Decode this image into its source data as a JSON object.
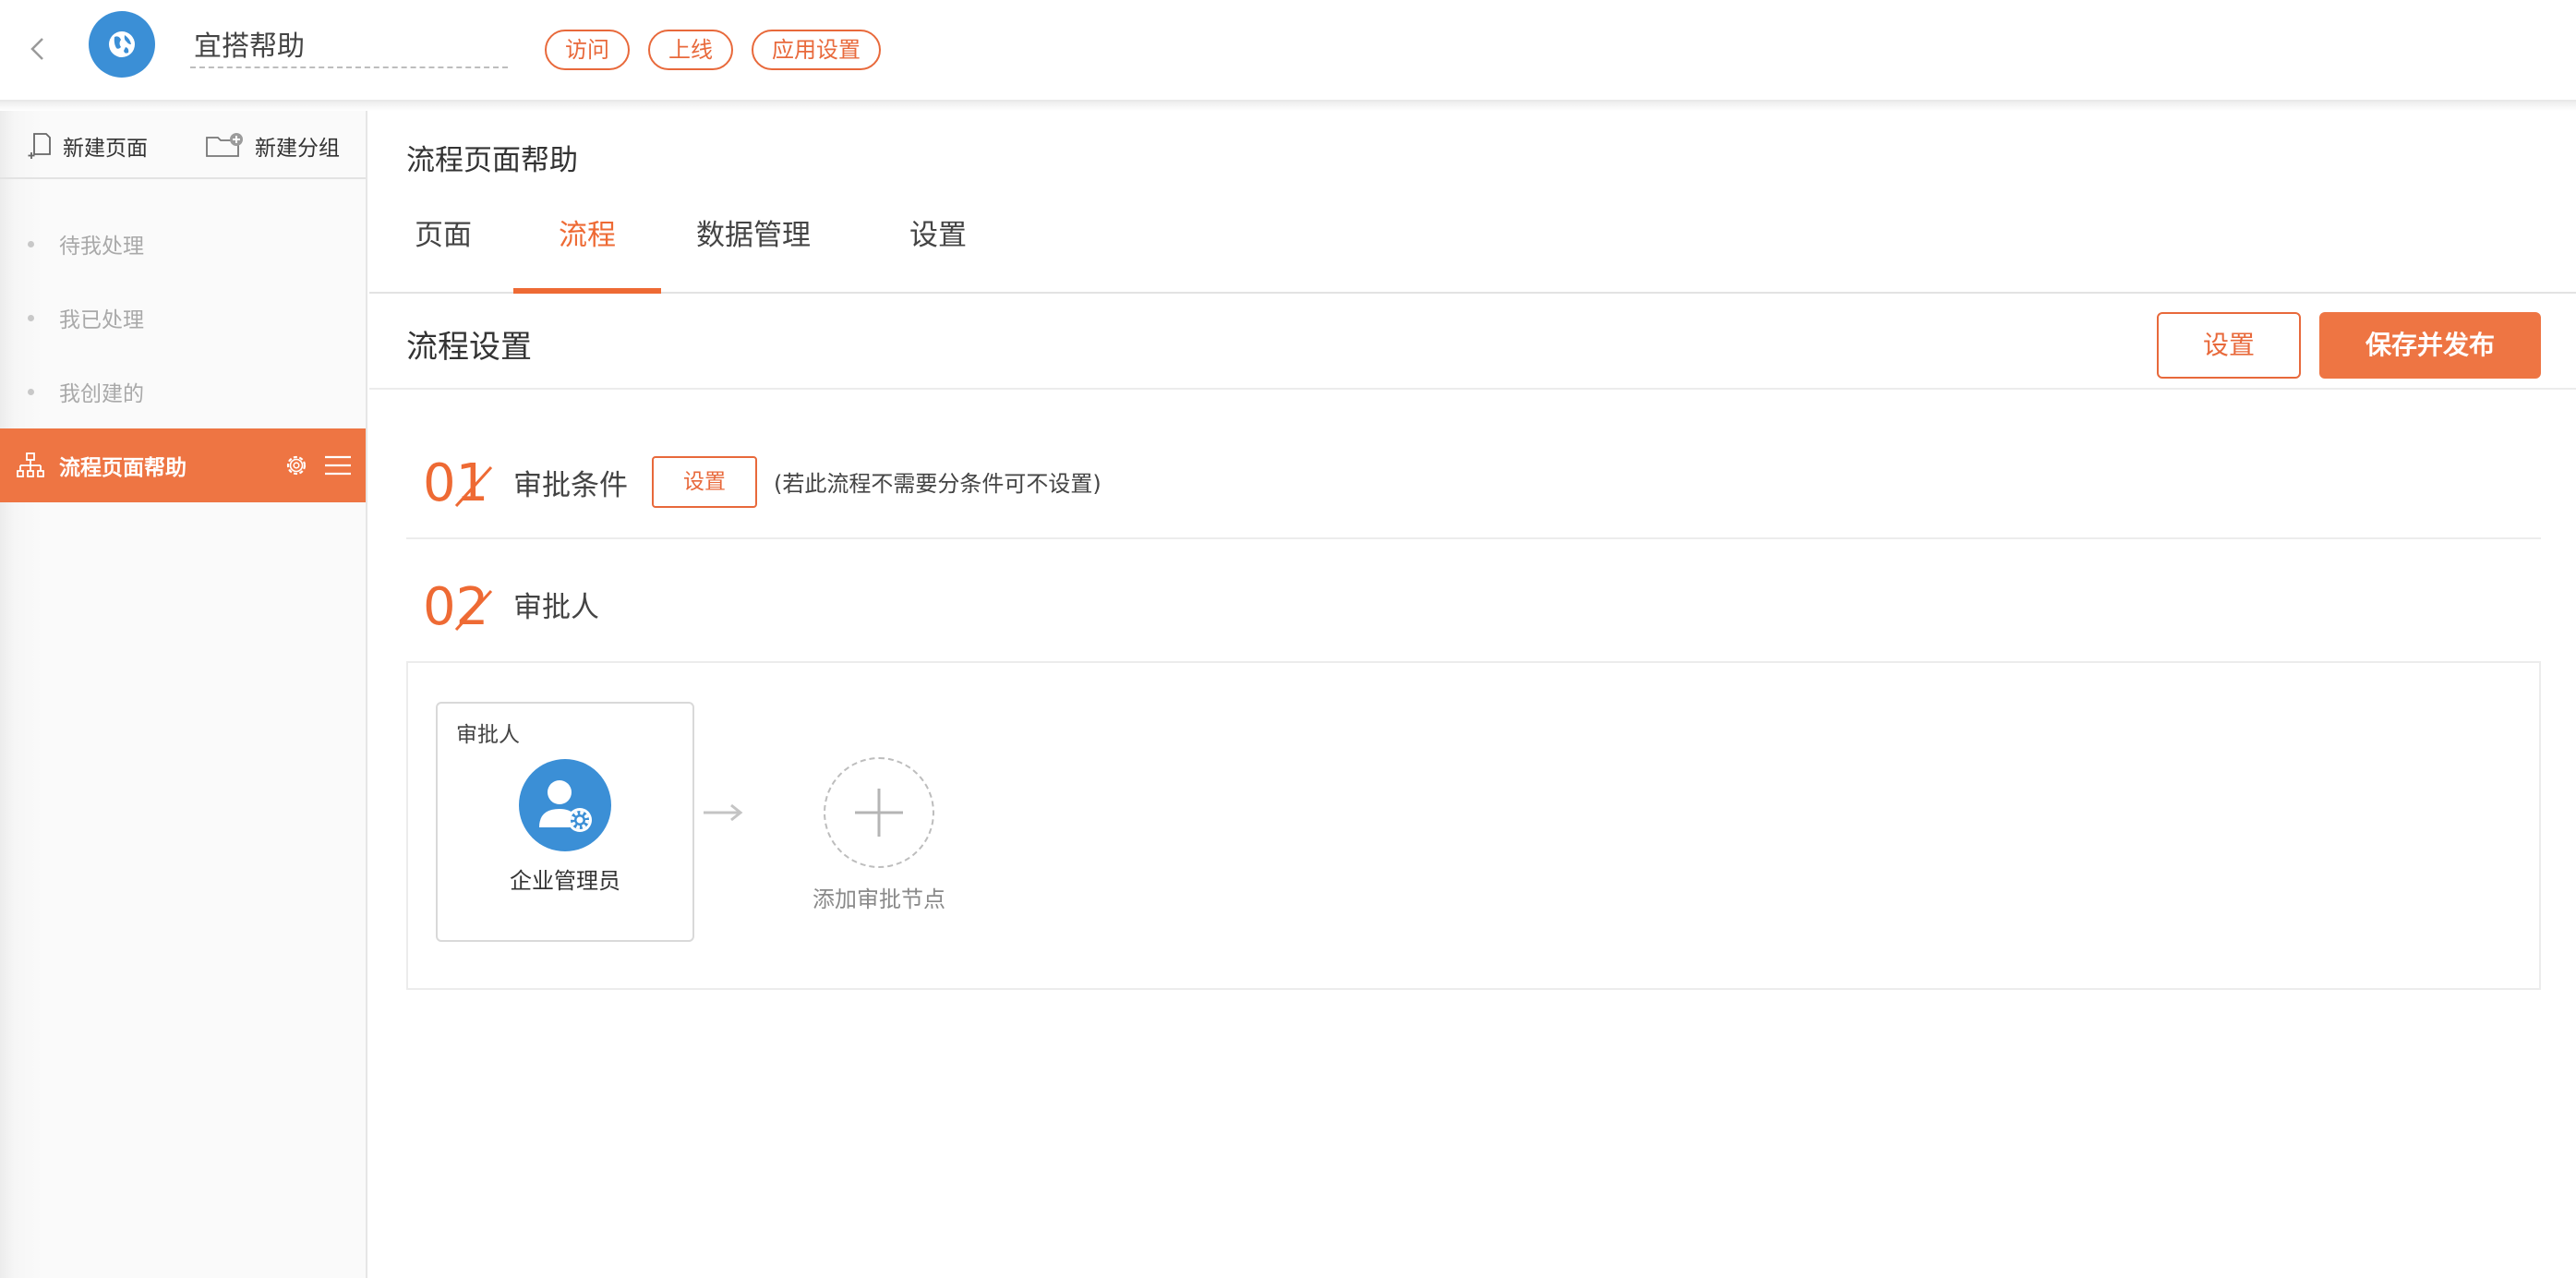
{
  "header": {
    "app_title": "宜搭帮助",
    "actions": [
      {
        "label": "访问"
      },
      {
        "label": "上线"
      },
      {
        "label": "应用设置"
      }
    ]
  },
  "sidebar": {
    "new_page_label": "新建页面",
    "new_group_label": "新建分组",
    "items": [
      {
        "label": "待我处理",
        "active": false
      },
      {
        "label": "我已处理",
        "active": false
      },
      {
        "label": "我创建的",
        "active": false
      },
      {
        "label": "流程页面帮助",
        "active": true
      }
    ]
  },
  "main": {
    "page_title": "流程页面帮助",
    "tabs": [
      {
        "label": "页面",
        "active": false
      },
      {
        "label": "流程",
        "active": true
      },
      {
        "label": "数据管理",
        "active": false
      },
      {
        "label": "设置",
        "active": false
      }
    ],
    "section_title": "流程设置",
    "settings_button": "设置",
    "publish_button": "保存并发布",
    "steps": [
      {
        "number": "01",
        "label": "审批条件",
        "button": "设置",
        "hint": "(若此流程不需要分条件可不设置)"
      },
      {
        "number": "02",
        "label": "审批人"
      }
    ],
    "flow": {
      "node": {
        "header": "审批人",
        "name": "企业管理员"
      },
      "add_label": "添加审批节点"
    }
  },
  "colors": {
    "accent": "#ee7543",
    "accent_text": "#e8693b",
    "logo_blue": "#3b8fd6"
  },
  "icons": {
    "back": "chevron-left-icon",
    "logo": "globe-icon",
    "new_page": "new-page-icon",
    "new_group": "new-folder-icon",
    "tree": "tree-structure-icon",
    "gear": "gear-icon",
    "menu": "menu-lines-icon",
    "approver": "user-gear-icon",
    "arrow": "arrow-right-icon",
    "add": "plus-icon"
  }
}
